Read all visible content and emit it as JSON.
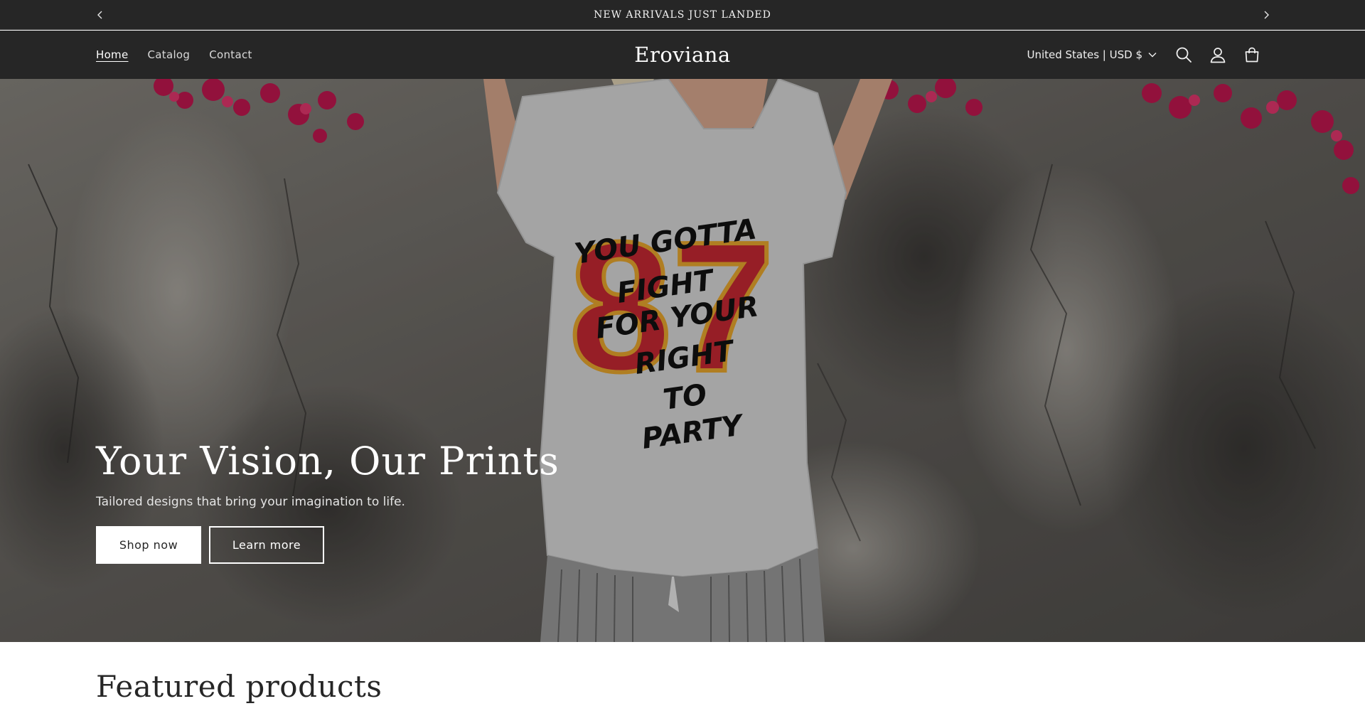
{
  "announcement": {
    "text": "NEW ARRIVALS JUST LANDED",
    "prev_icon": "chevron-left-icon",
    "next_icon": "chevron-right-icon"
  },
  "header": {
    "nav": [
      {
        "label": "Home",
        "active": true
      },
      {
        "label": "Catalog",
        "active": false
      },
      {
        "label": "Contact",
        "active": false
      }
    ],
    "brand": "Eroviana",
    "country_selector": "United States | USD $",
    "icons": [
      "search-icon",
      "account-icon",
      "cart-icon"
    ]
  },
  "hero": {
    "title": "Your Vision, Our Prints",
    "subtitle": "Tailored designs that bring your imagination to life.",
    "primary_button": "Shop now",
    "secondary_button": "Learn more",
    "shirt_graphic": {
      "number": "87",
      "lines": [
        "YOU GOTTA",
        "FIGHT",
        "FOR YOUR",
        "RIGHT",
        "TO",
        "PARTY"
      ]
    }
  },
  "featured": {
    "title": "Featured products"
  },
  "colors": {
    "header_bg": "#262626",
    "hero_text": "#ffffff",
    "accent_red": "#c42233"
  }
}
